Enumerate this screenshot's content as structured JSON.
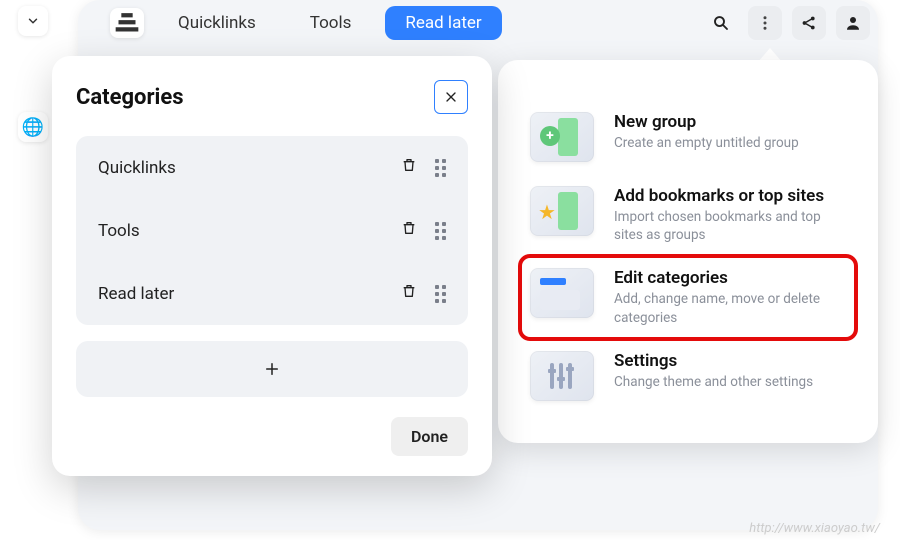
{
  "tabs": {
    "items": [
      "Quicklinks",
      "Tools",
      "Read later"
    ],
    "active_index": 2
  },
  "menu": {
    "items": [
      {
        "title": "New group",
        "sub": "Create an empty untitled group"
      },
      {
        "title": "Add bookmarks or top sites",
        "sub": "Import chosen bookmarks and top sites as groups"
      },
      {
        "title": "Edit categories",
        "sub": "Add, change name, move or delete categories"
      },
      {
        "title": "Settings",
        "sub": "Change theme and other settings"
      }
    ],
    "highlight_index": 2
  },
  "modal": {
    "title": "Categories",
    "categories": [
      "Quicklinks",
      "Tools",
      "Read later"
    ],
    "done_label": "Done"
  },
  "watermark": "http://www.xiaoyao.tw/"
}
